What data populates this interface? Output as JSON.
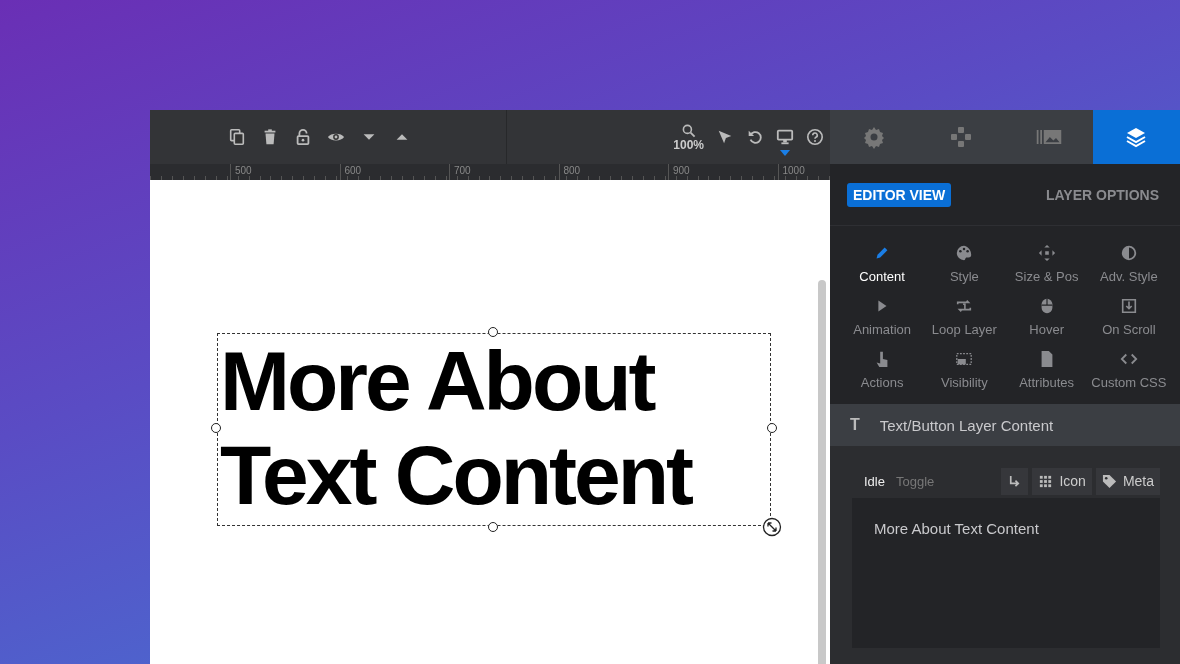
{
  "toolbar": {
    "zoom": "100%"
  },
  "ruler": {
    "ticks": [
      "500",
      "600",
      "700",
      "800",
      "900",
      "1000"
    ]
  },
  "canvas": {
    "layer_lines": [
      "More About",
      "Text Content"
    ],
    "selected": true
  },
  "panel": {
    "tabs": [
      {
        "selected": false
      },
      {
        "selected": false
      },
      {
        "selected": false
      },
      {
        "selected": true
      }
    ],
    "views": [
      {
        "label": "EDITOR VIEW",
        "selected": true
      },
      {
        "label": "LAYER OPTIONS",
        "selected": false
      }
    ],
    "options": [
      {
        "label": "Content",
        "selected": true
      },
      {
        "label": "Style",
        "selected": false
      },
      {
        "label": "Size & Pos",
        "selected": false
      },
      {
        "label": "Adv. Style",
        "selected": false
      },
      {
        "label": "Animation",
        "selected": false
      },
      {
        "label": "Loop Layer",
        "selected": false
      },
      {
        "label": "Hover",
        "selected": false
      },
      {
        "label": "On Scroll",
        "selected": false
      },
      {
        "label": "Actions",
        "selected": false
      },
      {
        "label": "Visibility",
        "selected": false
      },
      {
        "label": "Attributes",
        "selected": false
      },
      {
        "label": "Custom CSS",
        "selected": false
      }
    ],
    "section": {
      "icon": "T",
      "title": "Text/Button Layer Content"
    },
    "states": [
      {
        "label": "Idle",
        "selected": true
      },
      {
        "label": "Toggle",
        "selected": false
      }
    ],
    "tools": [
      {
        "kind": "arrow"
      },
      {
        "kind": "icon",
        "label": "Icon"
      },
      {
        "kind": "meta",
        "label": "Meta"
      }
    ],
    "content_value": "More About Text Content"
  }
}
